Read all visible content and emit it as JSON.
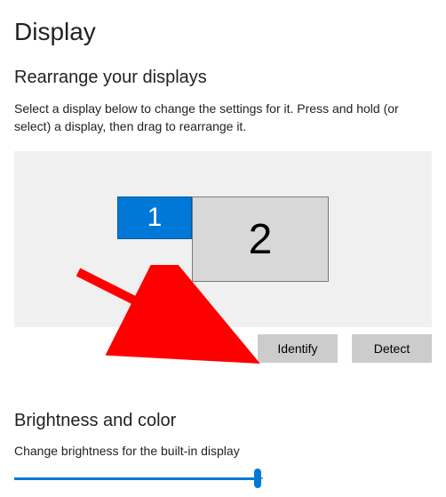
{
  "page_title": "Display",
  "rearrange": {
    "title": "Rearrange your displays",
    "description": "Select a display below to change the settings for it. Press and hold (or select) a display, then drag to rearrange it.",
    "monitors": {
      "m1": "1",
      "m2": "2"
    },
    "identify_label": "Identify",
    "detect_label": "Detect"
  },
  "brightness": {
    "title": "Brightness and color",
    "label": "Change brightness for the built-in display",
    "value_percent": 97
  },
  "annotation": {
    "arrow_target": "identify-button",
    "color": "#ff0000"
  }
}
